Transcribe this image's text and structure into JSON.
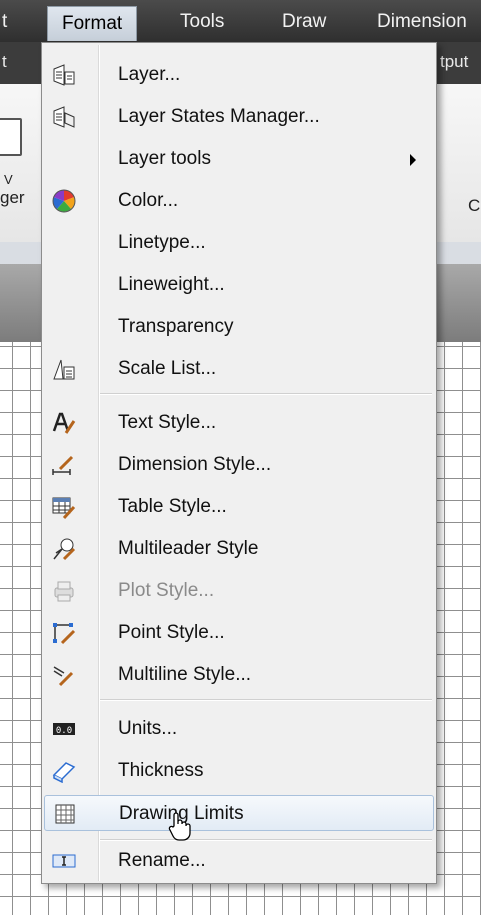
{
  "menubar": {
    "items": [
      {
        "label": "t"
      },
      {
        "label": "Format"
      },
      {
        "label": "Tools"
      },
      {
        "label": "Draw"
      },
      {
        "label": "Dimension"
      }
    ]
  },
  "ribbon_tabs": {
    "left_fragment": "t",
    "right_fragment": "tput"
  },
  "ribbon": {
    "left_label_1": "V",
    "left_label_2": "ger",
    "right_label": "C"
  },
  "format_menu": {
    "items": [
      {
        "label": "Layer...",
        "icon": "layer-properties-icon"
      },
      {
        "label": "Layer States Manager...",
        "icon": "layer-states-icon"
      },
      {
        "label": "Layer tools",
        "icon": "",
        "submenu": true
      },
      {
        "label": "Color...",
        "icon": "color-wheel-icon"
      },
      {
        "label": "Linetype...",
        "icon": ""
      },
      {
        "label": "Lineweight...",
        "icon": ""
      },
      {
        "label": "Transparency",
        "icon": ""
      },
      {
        "label": "Scale List...",
        "icon": "scale-list-icon"
      },
      {
        "label": "Text Style...",
        "icon": "text-style-icon"
      },
      {
        "label": "Dimension Style...",
        "icon": "dimension-style-icon"
      },
      {
        "label": "Table Style...",
        "icon": "table-style-icon"
      },
      {
        "label": "Multileader Style",
        "icon": "multileader-style-icon"
      },
      {
        "label": "Plot Style...",
        "icon": "plot-style-icon",
        "disabled": true
      },
      {
        "label": "Point Style...",
        "icon": "point-style-icon"
      },
      {
        "label": "Multiline Style...",
        "icon": "multiline-style-icon"
      },
      {
        "label": "Units...",
        "icon": "units-icon"
      },
      {
        "label": "Thickness",
        "icon": "thickness-icon"
      },
      {
        "label": "Drawing Limits",
        "icon": "drawing-limits-icon",
        "highlighted": true
      },
      {
        "label": "Rename...",
        "icon": "rename-icon"
      }
    ]
  },
  "colors": {
    "menu_background": "#f0f0f0",
    "highlight_border": "#a9c1dc",
    "menubar_background": "#3a3a3a"
  }
}
